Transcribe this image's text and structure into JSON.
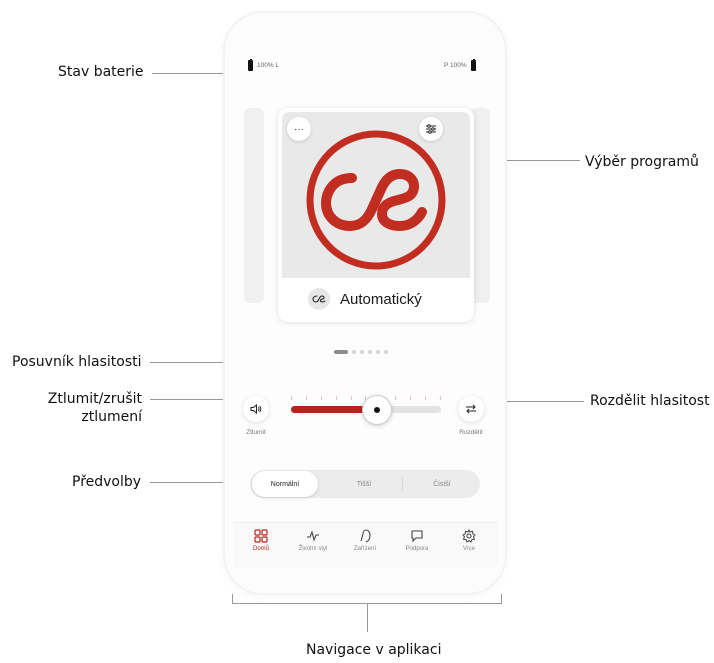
{
  "callouts": {
    "battery": "Stav baterie",
    "program": "Výběr programů",
    "volume_slider": "Posuvník hlasitosti",
    "mute_line1": "Ztlumit/zrušit",
    "mute_line2": "ztlumení",
    "split": "Rozdělit hlasitost",
    "presets": "Předvolby",
    "navigation": "Navigace v aplikaci"
  },
  "battery": {
    "left": "100% L",
    "right": "P 100%"
  },
  "program_card": {
    "name": "Automatický",
    "more_label": "···",
    "pager": {
      "count": 6,
      "active": 0
    }
  },
  "volume": {
    "level": 0.5,
    "mute_label": "Ztlumit",
    "split_label": "Rozdělit"
  },
  "presets": {
    "items": [
      "Normální",
      "Tišší",
      "Čistší"
    ],
    "active": 0
  },
  "nav": {
    "items": [
      {
        "label": "Domů",
        "icon": "grid-icon"
      },
      {
        "label": "Životní styl",
        "icon": "activity-icon"
      },
      {
        "label": "Zařízení",
        "icon": "hearing-aid-icon"
      },
      {
        "label": "Podpora",
        "icon": "chat-icon"
      },
      {
        "label": "Více",
        "icon": "gear-icon"
      }
    ],
    "active": 0
  },
  "colors": {
    "accent": "#b3261e",
    "logo_ring": "#c22d22"
  }
}
